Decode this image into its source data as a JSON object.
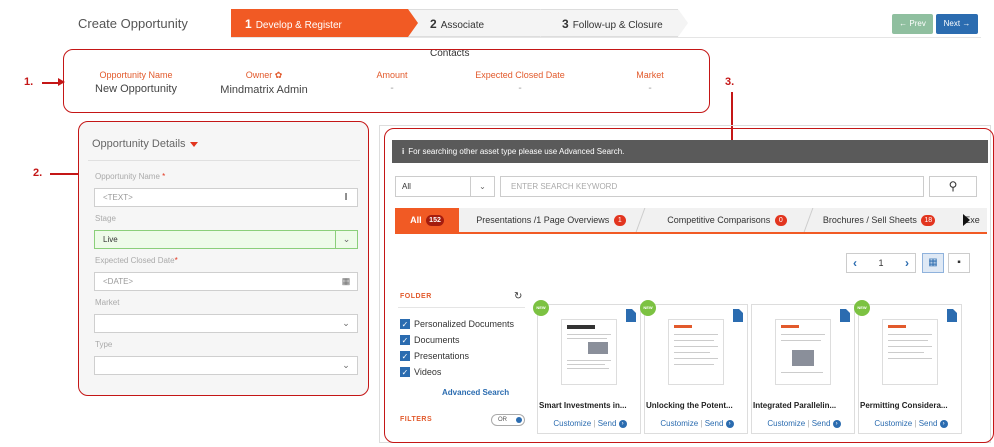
{
  "header": {
    "title": "Create Opportunity",
    "steps": [
      {
        "num": "1",
        "label": "Develop & Register Opportunity"
      },
      {
        "num": "2",
        "label": "Associate Contacts"
      },
      {
        "num": "3",
        "label": "Follow-up & Closure"
      }
    ],
    "prev_label": "← Prev",
    "next_label": "Next →"
  },
  "callouts": {
    "one": "1.",
    "two": "2.",
    "three": "3."
  },
  "summary": {
    "opportunity_name_label": "Opportunity Name",
    "opportunity_name_value": "New Opportunity",
    "owner_label": "Owner",
    "owner_value": "Mindmatrix Admin",
    "amount_label": "Amount",
    "amount_value": "-",
    "closed_date_label": "Expected Closed Date",
    "closed_date_value": "-",
    "market_label": "Market",
    "market_value": "-"
  },
  "details": {
    "title": "Opportunity Details",
    "name_label": "Opportunity Name",
    "name_placeholder": "<TEXT>",
    "stage_label": "Stage",
    "stage_value": "Live",
    "date_label": "Expected Closed Date",
    "date_placeholder": "<DATE>",
    "market_label": "Market",
    "market_value": "",
    "type_label": "Type",
    "type_value": ""
  },
  "assets": {
    "info": "For searching other asset type please use Advanced Search.",
    "filter_value": "All",
    "search_placeholder": "ENTER SEARCH KEYWORD",
    "tabs": [
      {
        "label": "All",
        "count": "152"
      },
      {
        "label": "Presentations /1 Page Overviews",
        "count": "1"
      },
      {
        "label": "Competitive Comparisons",
        "count": "0"
      },
      {
        "label": "Brochures / Sell Sheets",
        "count": "18"
      },
      {
        "label": "Exe",
        "count": ""
      }
    ],
    "page": "1",
    "folder_title": "FOLDER",
    "folders": [
      "Personalized Documents",
      "Documents",
      "Presentations",
      "Videos"
    ],
    "advanced_search": "Advanced Search",
    "filters_title": "FILTERS",
    "toggle_label": "OR",
    "new_badge": "NEW",
    "customize_label": "Customize",
    "send_label": "Send",
    "cards": [
      {
        "title": "Smart Investments in..."
      },
      {
        "title": "Unlocking the Potent..."
      },
      {
        "title": "Integrated Parallelin..."
      },
      {
        "title": "Permitting Considera..."
      }
    ]
  },
  "colors": {
    "accent": "#f15a24",
    "callout": "#c41616",
    "link": "#2b6cb0"
  }
}
